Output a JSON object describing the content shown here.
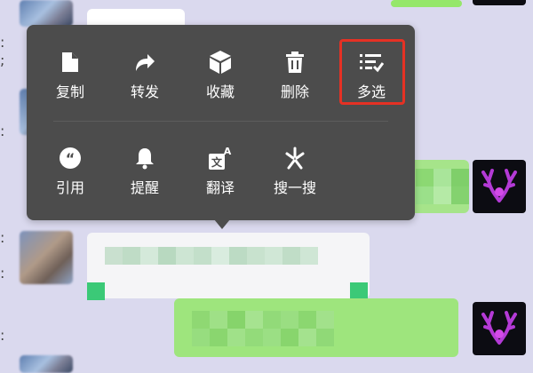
{
  "menu": {
    "row1": [
      {
        "label": "复制",
        "icon": "copy-icon"
      },
      {
        "label": "转发",
        "icon": "forward-icon"
      },
      {
        "label": "收藏",
        "icon": "favorite-icon"
      },
      {
        "label": "删除",
        "icon": "delete-icon"
      },
      {
        "label": "多选",
        "icon": "multi-select-icon"
      }
    ],
    "row2": [
      {
        "label": "引用",
        "icon": "quote-icon"
      },
      {
        "label": "提醒",
        "icon": "remind-icon"
      },
      {
        "label": "翻译",
        "icon": "translate-icon"
      },
      {
        "label": "搜一搜",
        "icon": "search-icon"
      }
    ],
    "highlighted_item": "多选"
  },
  "colors": {
    "background": "#dad9ee",
    "menu_background": "#4c4c4c",
    "menu_text": "#ffffff",
    "highlight": "#e53124",
    "own_bubble": "#95e76a",
    "other_bubble": "#ffffff"
  }
}
